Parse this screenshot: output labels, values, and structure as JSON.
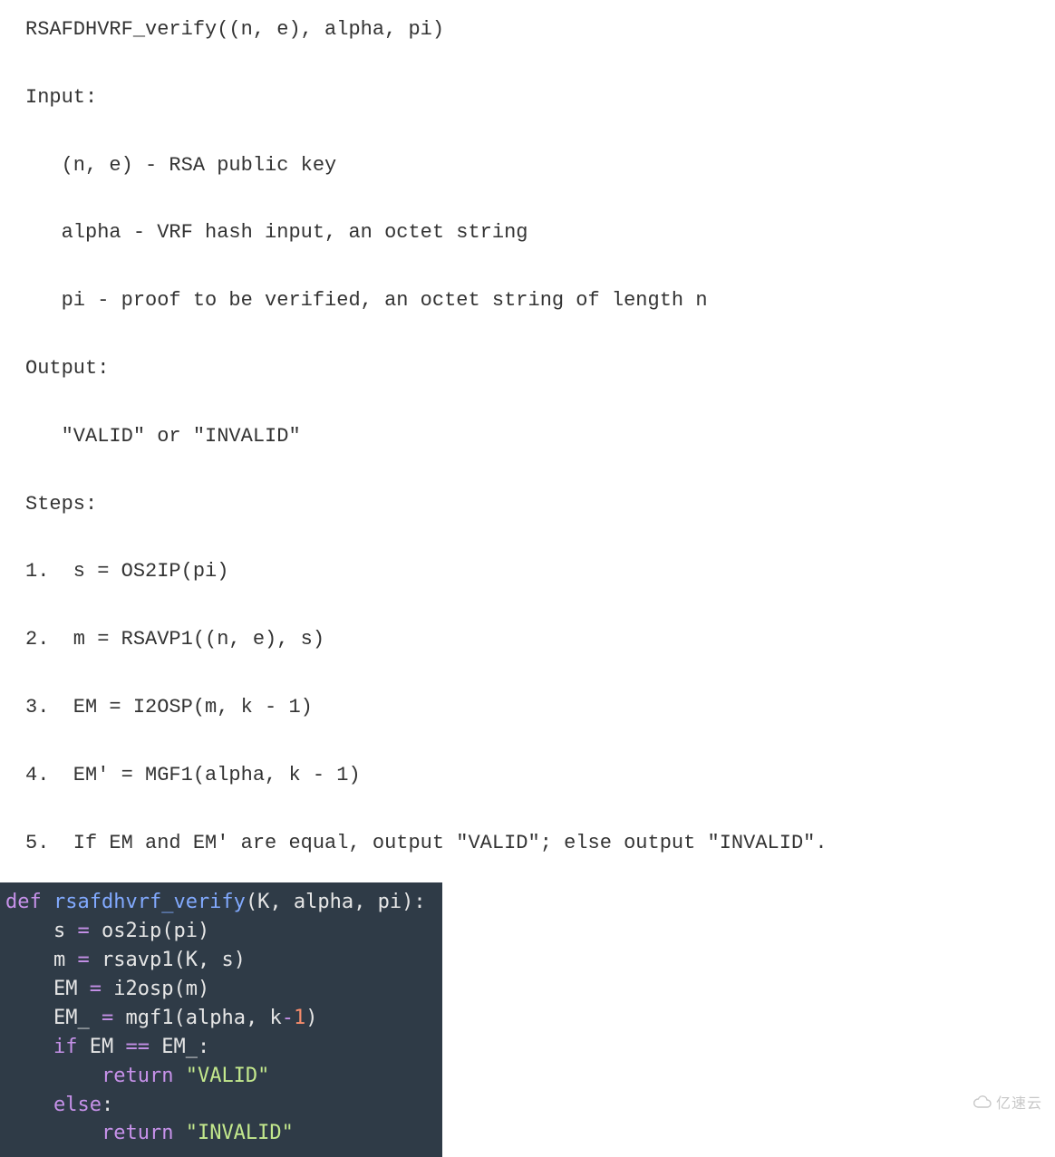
{
  "algo": {
    "title": "RSAFDHVRF_verify((n, e), alpha, pi)",
    "input_label": "Input:",
    "inputs": [
      "   (n, e) - RSA public key",
      "   alpha - VRF hash input, an octet string",
      "   pi - proof to be verified, an octet string of length n"
    ],
    "output_label": "Output:",
    "output_value": "   \"VALID\" or \"INVALID\"",
    "steps_label": "Steps:",
    "steps": [
      "1.  s = OS2IP(pi)",
      "2.  m = RSAVP1((n, e), s)",
      "3.  EM = I2OSP(m, k - 1)",
      "4.  EM' = MGF1(alpha, k - 1)",
      "5.  If EM and EM' are equal, output \"VALID\"; else output \"INVALID\"."
    ]
  },
  "code": {
    "def": "def",
    "fn_name": "rsafdhvrf_verify",
    "params_open": "(",
    "p_K": "K",
    "comma1": ", ",
    "p_alpha": "alpha",
    "comma2": ", ",
    "p_pi": "pi",
    "params_close": "):",
    "l2_s": "s",
    "eq": " = ",
    "l2_call": "os2ip",
    "l2_open": "(",
    "l2_arg": "pi",
    "l2_close": ")",
    "l3_m": "m",
    "l3_call": "rsavp1",
    "l3_open": "(",
    "l3_a1": "K",
    "l3_comma": ", ",
    "l3_a2": "s",
    "l3_close": ")",
    "l4_EM": "EM",
    "l4_call": "i2osp",
    "l4_open": "(",
    "l4_arg": "m",
    "l4_close": ")",
    "l5_EM_": "EM_",
    "l5_call": "mgf1",
    "l5_open": "(",
    "l5_a1": "alpha",
    "l5_comma": ", ",
    "l5_k": "k",
    "l5_minus": "-",
    "l5_one": "1",
    "l5_close": ")",
    "if": "if",
    "l6_lhs": "EM",
    "eqeq": " == ",
    "l6_rhs": "EM_",
    "colon": ":",
    "return": "return",
    "str_valid": "\"VALID\"",
    "else": "else",
    "str_invalid": "\"INVALID\""
  },
  "watermark": {
    "text": "亿速云"
  }
}
